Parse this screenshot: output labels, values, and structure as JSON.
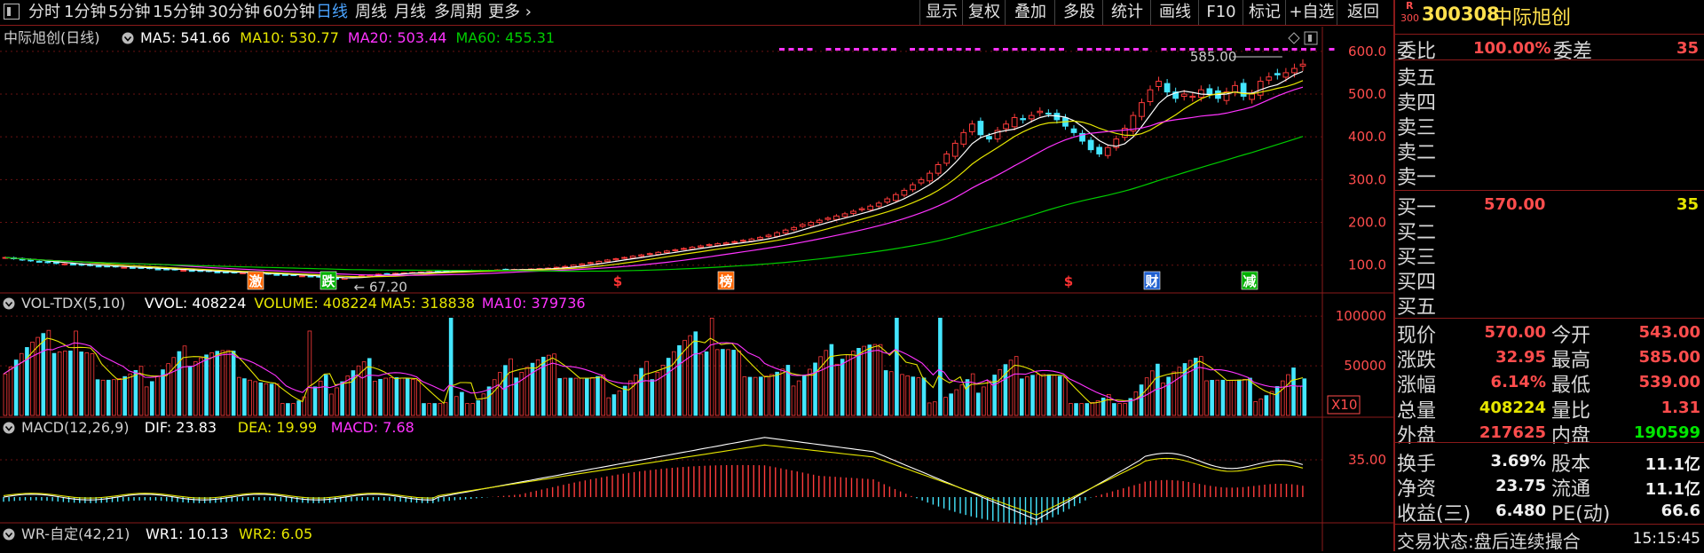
{
  "toolbar": {
    "periods": [
      "分时",
      "1分钟",
      "5分钟",
      "15分钟",
      "30分钟",
      "60分钟",
      "日线",
      "周线",
      "月线",
      "多周期",
      "更多"
    ],
    "active": "日线",
    "right_buttons": [
      "显示",
      "复权",
      "叠加",
      "多股",
      "统计",
      "画线",
      "F10",
      "标记",
      "+自选",
      "返回"
    ]
  },
  "main_panel": {
    "title": "中际旭创(日线)",
    "ma": [
      {
        "label": "MA5: 541.66",
        "color": "#ffffff"
      },
      {
        "label": "MA10: 530.77",
        "color": "#e6e600"
      },
      {
        "label": "MA20: 503.44",
        "color": "#ff33ff"
      },
      {
        "label": "MA60: 455.31",
        "color": "#00cc00"
      }
    ],
    "high_marker": "585.00",
    "low_marker": "67.20",
    "event_tags": [
      {
        "text": "激",
        "bg": "#ff6600",
        "color": "#ffffff"
      },
      {
        "text": "跌",
        "bg": "#00b000",
        "color": "#ffffff"
      },
      {
        "text": "$",
        "bg": "#000000",
        "color": "#ff3333"
      },
      {
        "text": "榜",
        "bg": "#ff6600",
        "color": "#ffffff"
      },
      {
        "text": "$",
        "bg": "#000000",
        "color": "#ff3333"
      },
      {
        "text": "财",
        "bg": "#1e5fd0",
        "color": "#ffffff"
      },
      {
        "text": "减",
        "bg": "#00b000",
        "color": "#ffffff"
      }
    ]
  },
  "vol_panel": {
    "title": "VOL-TDX(5,10)",
    "items": [
      {
        "label": "VVOL: 408224",
        "color": "#ffffff"
      },
      {
        "label": "VOLUME: 408224",
        "color": "#e6e600"
      },
      {
        "label": "MA5: 318838",
        "color": "#e6e600"
      },
      {
        "label": "MA10: 379736",
        "color": "#ff33ff"
      }
    ],
    "multiplier": "X10"
  },
  "macd_panel": {
    "title": "MACD(12,26,9)",
    "items": [
      {
        "label": "DIF: 23.83",
        "color": "#ffffff"
      },
      {
        "label": "DEA: 19.99",
        "color": "#e6e600"
      },
      {
        "label": "MACD: 7.68",
        "color": "#ff33ff"
      }
    ]
  },
  "wr_panel": {
    "title": "WR-自定(42,21)",
    "items": [
      {
        "label": "WR1: 10.13",
        "color": "#ffffff"
      },
      {
        "label": "WR2: 6.05",
        "color": "#e6e600"
      }
    ]
  },
  "chart_data": [
    {
      "type": "candlestick",
      "title": "中际旭创(日线)",
      "y_ticks": [
        100.0,
        200.0,
        300.0,
        400.0,
        500.0,
        600.0
      ],
      "y_tick_labels": [
        "100.0",
        "200.0",
        "300.0",
        "400.0",
        "500.0",
        "600.0"
      ],
      "ylim": [
        60,
        610
      ],
      "last_close": 570.0,
      "high": 585.0,
      "low": 67.2,
      "ma_last": {
        "MA5": 541.66,
        "MA10": 530.77,
        "MA20": 503.44,
        "MA60": 455.31
      },
      "close_series": [
        118,
        115,
        112,
        110,
        108,
        106,
        104,
        103,
        102,
        100,
        99,
        98,
        97,
        96,
        95,
        94,
        93,
        92,
        91,
        90,
        89,
        88,
        87,
        86,
        85,
        84,
        83,
        82,
        82,
        81,
        80,
        79,
        78,
        77,
        76,
        75,
        74,
        72,
        70,
        67.2,
        70,
        73,
        75,
        77,
        79,
        80,
        81,
        82,
        83,
        84,
        85,
        85,
        86,
        86,
        87,
        87,
        88,
        88,
        89,
        89,
        90,
        90,
        91,
        92,
        93,
        95,
        97,
        100,
        103,
        106,
        109,
        112,
        115,
        118,
        121,
        124,
        127,
        130,
        133,
        136,
        139,
        142,
        145,
        148,
        150,
        152,
        155,
        158,
        161,
        165,
        170,
        176,
        182,
        188,
        195,
        200,
        205,
        210,
        215,
        220,
        226,
        232,
        238,
        245,
        255,
        265,
        275,
        288,
        300,
        315,
        335,
        360,
        385,
        410,
        430,
        405,
        395,
        415,
        430,
        445,
        440,
        450,
        460,
        455,
        440,
        425,
        410,
        390,
        370,
        360,
        375,
        395,
        420,
        450,
        480,
        510,
        530,
        505,
        490,
        500,
        495,
        510,
        500,
        490,
        505,
        520,
        495,
        500,
        530,
        540,
        545,
        550,
        560,
        570
      ]
    },
    {
      "type": "bar",
      "title": "VOL-TDX(5,10)",
      "y_ticks": [
        50000,
        100000
      ],
      "y_tick_labels": [
        "50000",
        "100000"
      ],
      "unit_multiplier": 10,
      "last_volume": 408224,
      "ma_last": {
        "MA5": 318838,
        "MA10": 379736
      }
    },
    {
      "type": "line",
      "title": "MACD(12,26,9)",
      "y_ticks": [
        35.0
      ],
      "y_tick_labels": [
        "35.00"
      ],
      "last": {
        "DIF": 23.83,
        "DEA": 19.99,
        "MACD": 7.68
      }
    },
    {
      "type": "line",
      "title": "WR-自定(42,21)",
      "last": {
        "WR1": 10.13,
        "WR2": 6.05
      }
    }
  ],
  "quote": {
    "code": "300308",
    "name": "中际旭创",
    "badge_top": "R",
    "badge_bottom": "300",
    "weibi_label": "委比",
    "weibi": "100.00%",
    "weicha_label": "委差",
    "weicha": "35",
    "sell": [
      "卖五",
      "卖四",
      "卖三",
      "卖二",
      "卖一"
    ],
    "buy": [
      {
        "label": "买一",
        "price": "570.00",
        "vol": "35"
      },
      {
        "label": "买二",
        "price": "",
        "vol": ""
      },
      {
        "label": "买三",
        "price": "",
        "vol": ""
      },
      {
        "label": "买四",
        "price": "",
        "vol": ""
      },
      {
        "label": "买五",
        "price": "",
        "vol": ""
      }
    ],
    "rows": [
      {
        "l1": "现价",
        "v1": "570.00",
        "c1": "red",
        "l2": "今开",
        "v2": "543.00",
        "c2": "red"
      },
      {
        "l1": "涨跌",
        "v1": "32.95",
        "c1": "red",
        "l2": "最高",
        "v2": "585.00",
        "c2": "red"
      },
      {
        "l1": "涨幅",
        "v1": "6.14%",
        "c1": "red",
        "l2": "最低",
        "v2": "539.00",
        "c2": "red"
      },
      {
        "l1": "总量",
        "v1": "408224",
        "c1": "yel",
        "l2": "量比",
        "v2": "1.31",
        "c2": "red"
      },
      {
        "l1": "外盘",
        "v1": "217625",
        "c1": "red",
        "l2": "内盘",
        "v2": "190599",
        "c2": "grn"
      },
      {
        "l1": "换手",
        "v1": "3.69%",
        "c1": "wht",
        "l2": "股本",
        "v2": "11.1亿",
        "c2": "wht"
      },
      {
        "l1": "净资",
        "v1": "23.75",
        "c1": "wht",
        "l2": "流通",
        "v2": "11.1亿",
        "c2": "wht"
      },
      {
        "l1": "收益(三)",
        "v1": "6.480",
        "c1": "wht",
        "l2": "PE(动)",
        "v2": "66.6",
        "c2": "wht"
      }
    ],
    "status_label": "交易状态:",
    "status": "盘后连续撮合",
    "time": "15:15:45"
  }
}
